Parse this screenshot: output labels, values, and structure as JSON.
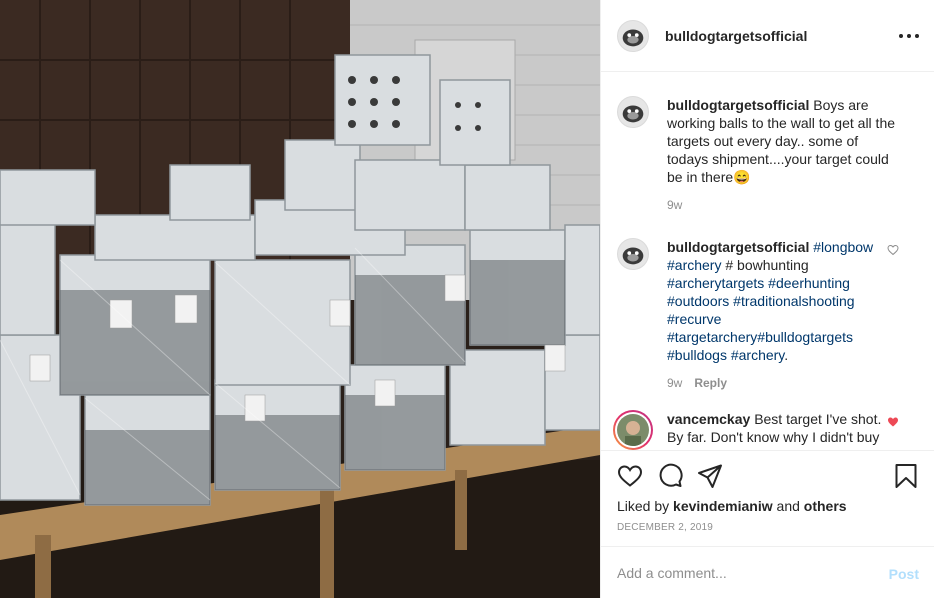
{
  "post": {
    "photo_icon": "shipment-photo",
    "author": "bulldogtargetsofficial",
    "more_icon": "more-options-icon"
  },
  "caption": {
    "user": "bulldogtargetsofficial",
    "text": "Boys are working balls to the wall to get all the targets out every day.. some of todays shipment....your target could be in there",
    "emoji": "😄",
    "time": "9w"
  },
  "comments": [
    {
      "user": "bulldogtargetsofficial",
      "text_parts": [
        "#longbow",
        " ",
        "#archery",
        " # bowhunting ",
        "#archerytargets",
        " ",
        "#deerhunting",
        " ",
        "#outdoors",
        " ",
        "#traditionalshooting",
        " ",
        "#recurve",
        " ",
        "#targetarchery",
        "",
        "#bulldogtargets",
        " ",
        "#bulldogs",
        " ",
        "#archery",
        "."
      ],
      "time": "9w",
      "reply": "Reply",
      "liked": false
    },
    {
      "user": "vancemckay",
      "text": "Best target I've shot. By far. Don't know why I didn't buy",
      "liked": true
    }
  ],
  "actions": {
    "like_icon": "heart-icon",
    "comment_icon": "comment-icon",
    "share_icon": "share-icon",
    "save_icon": "bookmark-icon",
    "liked_by_prefix": "Liked by",
    "liked_by_user": "kevindemianiw",
    "liked_by_and": "and",
    "liked_by_others": "others",
    "date": "DECEMBER 2, 2019"
  },
  "add_comment": {
    "placeholder": "Add a comment...",
    "post_label": "Post"
  },
  "colors": {
    "link": "#00376b",
    "secondary": "#8e8e8e",
    "liked_heart": "#ed4956",
    "post_disabled": "#b2dffc"
  }
}
